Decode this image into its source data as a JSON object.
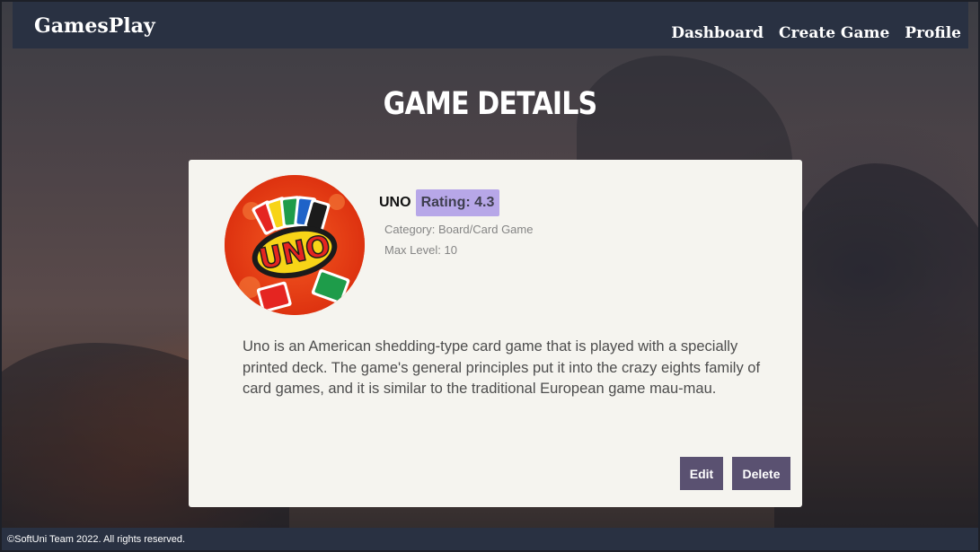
{
  "header": {
    "logo": "GamesPlay",
    "nav": [
      "Dashboard",
      "Create Game",
      "Profile"
    ]
  },
  "page": {
    "title": "GAME DETAILS"
  },
  "game": {
    "title": "UNO",
    "rating": "Rating: 4.3",
    "category": "Category: Board/Card Game",
    "max_level": "Max Level: 10",
    "image_logo_text": "UNO",
    "summary": "Uno is an American shedding-type card game that is played with a specially printed deck. The game's general principles put it into the crazy eights family of card games, and it is similar to the traditional European game mau-mau."
  },
  "actions": {
    "edit": "Edit",
    "delete": "Delete"
  },
  "footer": {
    "text": "©SoftUni Team 2022. All rights reserved."
  },
  "colors": {
    "header_bg": "#293142",
    "button_bg": "#5a5171",
    "rating_bg": "#b7a7e8",
    "card_bg": "#f5f4ef"
  }
}
